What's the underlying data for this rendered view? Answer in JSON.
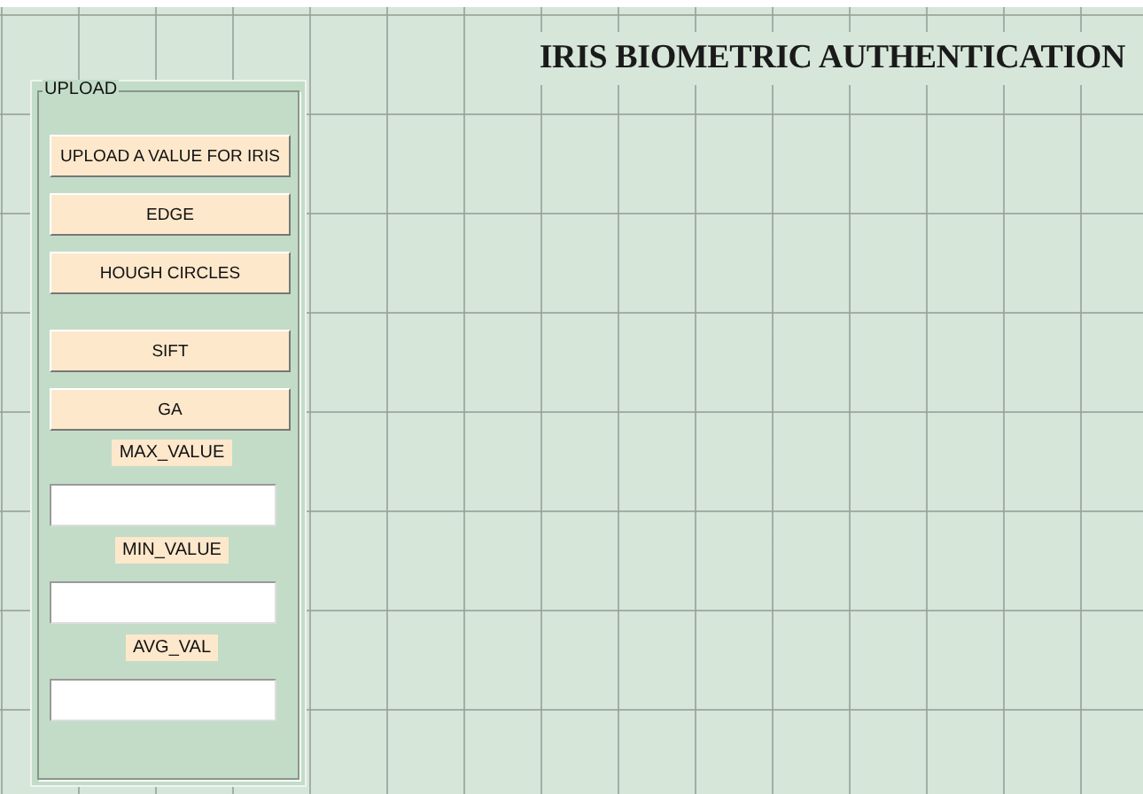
{
  "title": "IRIS BIOMETRIC AUTHENTICATION",
  "panel": {
    "title": "UPLOAD",
    "button_groups": [
      [
        {
          "label": "UPLOAD A VALUE FOR IRIS"
        },
        {
          "label": "EDGE"
        },
        {
          "label": "HOUGH CIRCLES"
        }
      ],
      [
        {
          "label": "SIFT"
        },
        {
          "label": "GA"
        }
      ]
    ],
    "fields": [
      {
        "label": "MAX_VALUE"
      },
      {
        "label": "MIN_VALUE"
      },
      {
        "label": "AVG_VAL"
      }
    ]
  }
}
